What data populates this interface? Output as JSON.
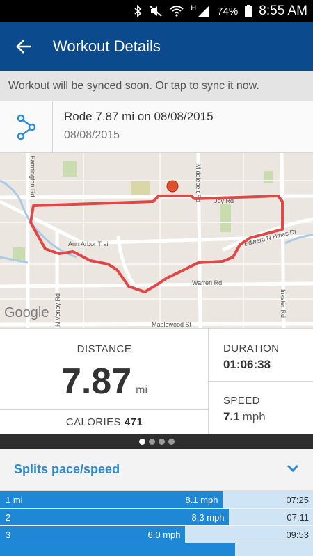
{
  "status": {
    "battery": "74%",
    "time": "8:55 AM",
    "network": "H"
  },
  "appbar": {
    "title": "Workout Details"
  },
  "sync": {
    "message": "Workout will be synced soon. Or tap to sync it now."
  },
  "header": {
    "title": "Rode 7.87 mi on 08/08/2015",
    "subtitle": "08/08/2015",
    "icon": "route-icon"
  },
  "map": {
    "labels": {
      "farmington": "Farmington Rd",
      "middlebelt": "Middlebelt Rd",
      "joy": "Joy Rd",
      "annarbor": "Ann Arbor Trail",
      "hines": "Edward N Hines Dr",
      "warren": "Warren Rd",
      "venoy": "N Venoy Rd",
      "inkster": "Inkster Rd",
      "maplewood": "Maplewood St"
    },
    "logo": "Google",
    "route_color": "#e04848"
  },
  "stats": {
    "distance_label": "DISTANCE",
    "distance_value": "7.87",
    "distance_unit": "mi",
    "calories_label": "CALORIES",
    "calories_value": "471",
    "duration_label": "DURATION",
    "duration_value": "01:06:38",
    "speed_label": "SPEED",
    "speed_value": "7.1",
    "speed_unit": "mph"
  },
  "pager": {
    "count": 4,
    "active": 0
  },
  "splits": {
    "title": "Splits pace/speed",
    "rows": [
      {
        "lap": "1 mi",
        "speed": "8.1 mph",
        "pace": "07:25",
        "fill": 0.71
      },
      {
        "lap": "2",
        "speed": "8.3 mph",
        "pace": "07:11",
        "fill": 0.73
      },
      {
        "lap": "3",
        "speed": "6.0 mph",
        "pace": "09:53",
        "fill": 0.59
      },
      {
        "lap": "",
        "speed": "",
        "pace": "",
        "fill": 0.75
      }
    ]
  },
  "colors": {
    "appbar": "#0b4a8c",
    "accent": "#2a8ad1",
    "split_bar": "#1e87d6",
    "split_track": "#cfe4f5"
  }
}
